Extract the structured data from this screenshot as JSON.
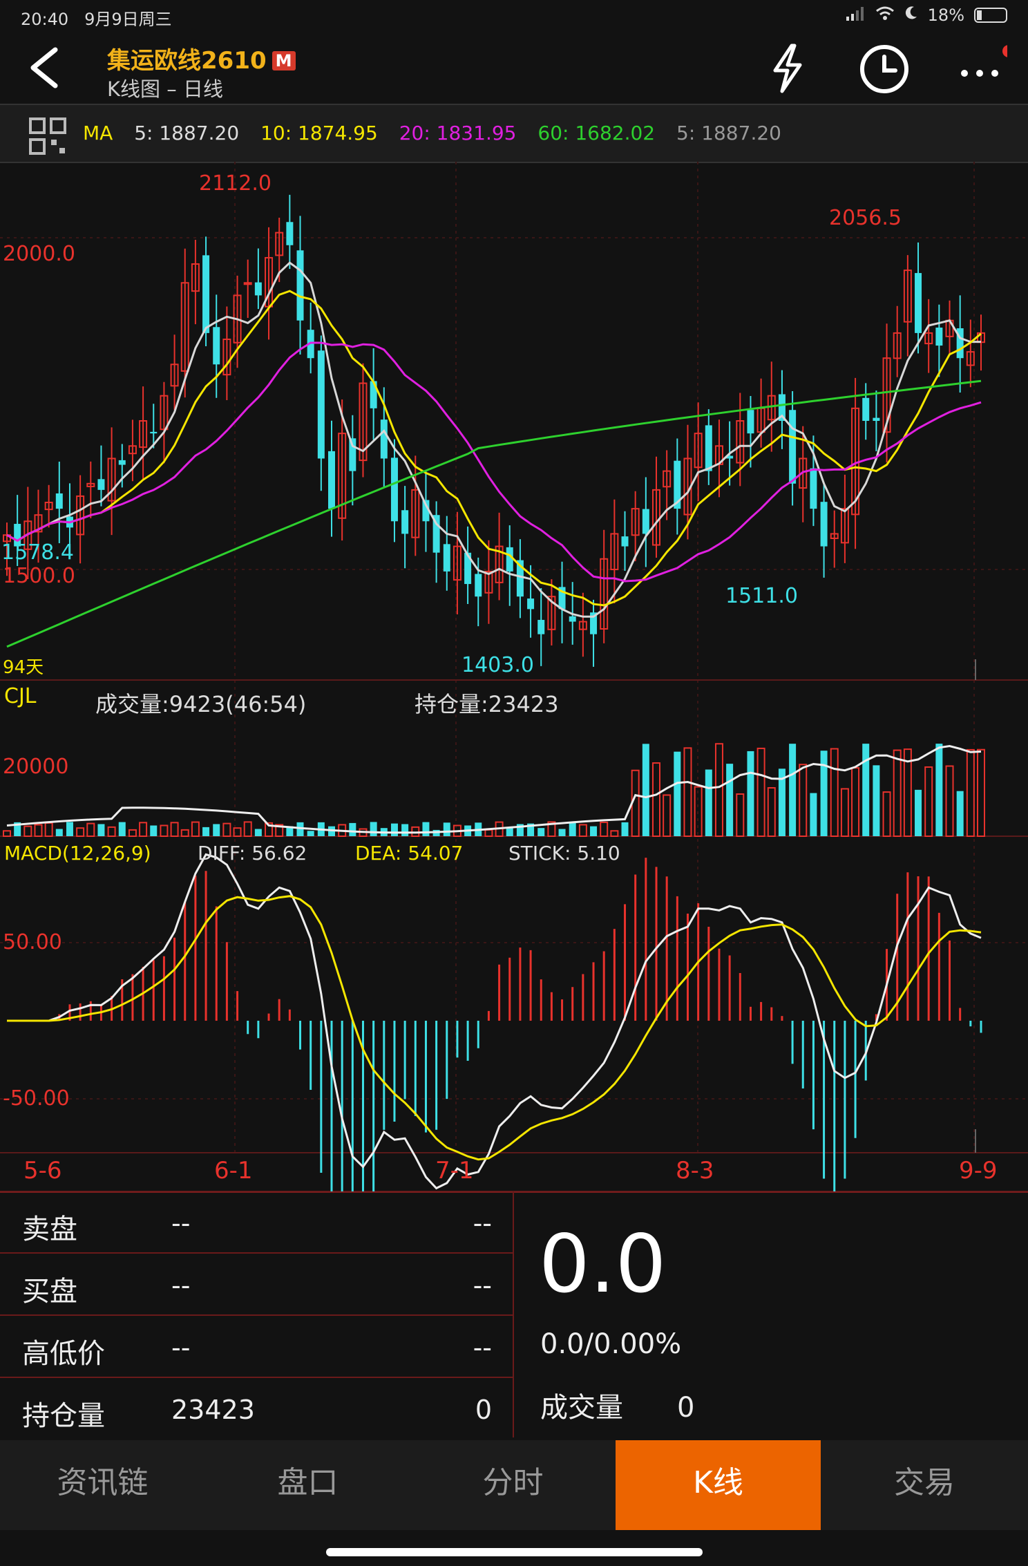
{
  "status": {
    "time": "20:40",
    "date": "9月9日周三",
    "battery": "18%",
    "battery_level": 0.18
  },
  "header": {
    "title": "集运欧线2610",
    "badge": "M",
    "subtitle": "K线图 – 日线",
    "icons": [
      "back-arrow-icon",
      "lightning-icon",
      "clock-icon",
      "more-icon"
    ]
  },
  "ma_bar": {
    "label": "MA",
    "ma5": "5: 1887.20",
    "ma10": "10: 1874.95",
    "ma20": "20: 1831.95",
    "ma60": "60: 1682.02",
    "ma5b": "5: 1887.20",
    "colors": {
      "ma5": "#d8d8d8",
      "ma10": "#f5e600",
      "ma20": "#e020e0",
      "ma60": "#2ed12e"
    }
  },
  "price_panel": {
    "high_label": "2112.0",
    "high2_label": "2056.5",
    "level_2000": "2000.0",
    "level_1500": "1500.0",
    "start_label": "1578.4",
    "low_label": "1403.0",
    "low2_label": "1511.0",
    "days_label": "94天"
  },
  "volume_panel": {
    "label": "CJL",
    "volume_text": "成交量:9423(46:54)",
    "oi_text": "持仓量:23423",
    "level": "20000"
  },
  "macd_panel": {
    "label": "MACD(12,26,9)",
    "diff": "DIFF: 56.62",
    "dea": "DEA: 54.07",
    "stick": "STICK: 5.10",
    "level_pos": "50.00",
    "level_neg": "-50.00"
  },
  "x_axis": [
    "5-6",
    "6-1",
    "7-1",
    "8-3",
    "9-9"
  ],
  "chart_data": {
    "type": "candlestick",
    "days": 94,
    "ohlc_close": [
      1578,
      1560,
      1600,
      1610,
      1630,
      1620,
      1590,
      1640,
      1660,
      1650,
      1700,
      1690,
      1720,
      1760,
      1740,
      1800,
      1850,
      1980,
      2010,
      1900,
      1850,
      1890,
      1960,
      1980,
      1960,
      2020,
      2060,
      2040,
      1920,
      1860,
      1700,
      1620,
      1740,
      1680,
      1820,
      1780,
      1700,
      1600,
      1580,
      1650,
      1600,
      1550,
      1520,
      1560,
      1500,
      1480,
      1520,
      1560,
      1520,
      1480,
      1460,
      1420,
      1480,
      1460,
      1440,
      1440,
      1420,
      1540,
      1580,
      1560,
      1620,
      1580,
      1650,
      1680,
      1620,
      1700,
      1740,
      1680,
      1720,
      1700,
      1760,
      1740,
      1780,
      1800,
      1760,
      1660,
      1700,
      1620,
      1560,
      1580,
      1620,
      1780,
      1760,
      1760,
      1860,
      1900,
      2000,
      1900,
      1900,
      1880,
      1920,
      1860,
      1870,
      1900
    ],
    "ma60_end": 1682.02,
    "ma20_end": 1831.95,
    "ma10_end": 1874.95,
    "ma5_end": 1887.2,
    "high": 2112.0,
    "low": 1403.0
  }
}
